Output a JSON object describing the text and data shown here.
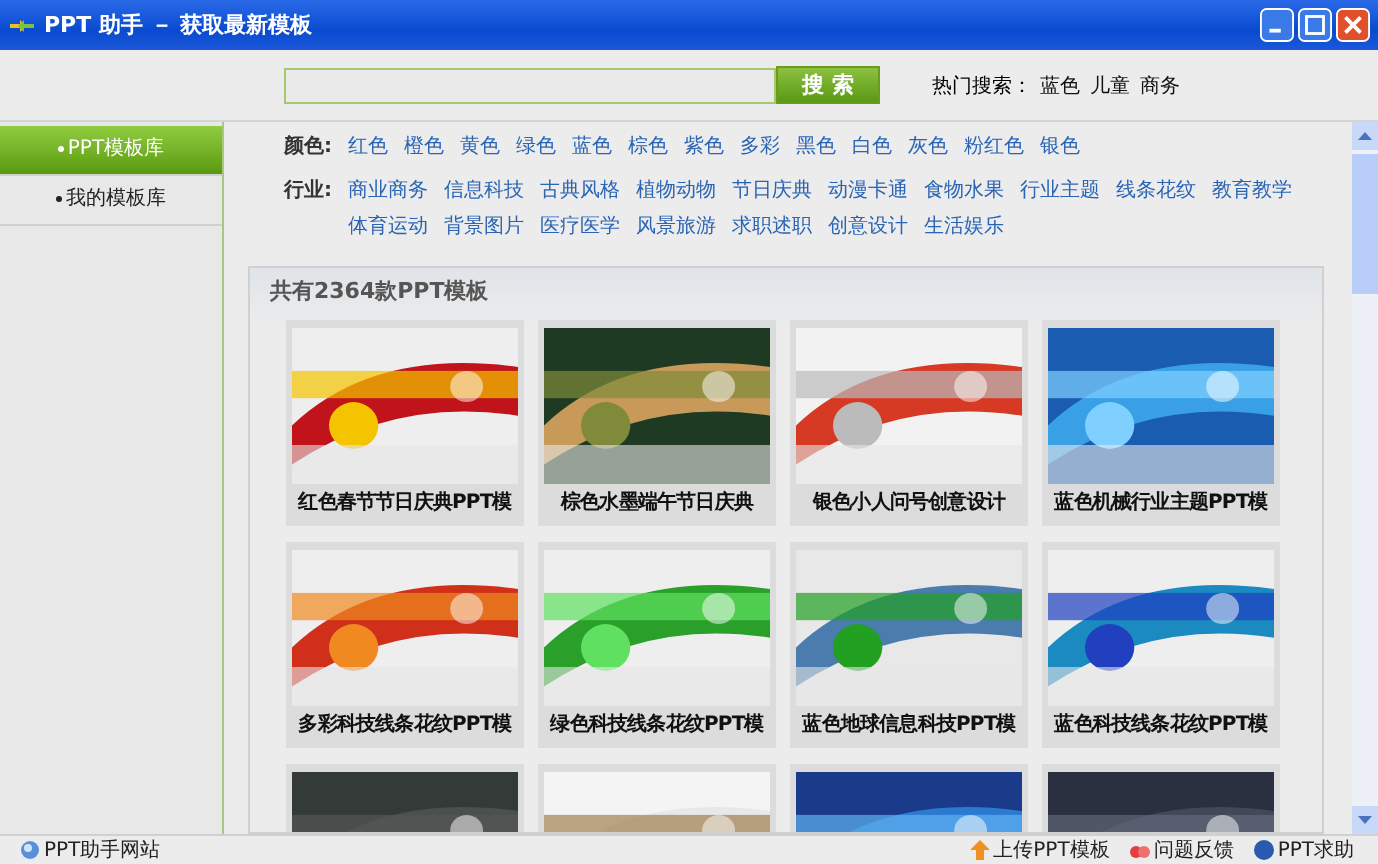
{
  "window": {
    "title": "PPT 助手 － 获取最新模板"
  },
  "search": {
    "button": "搜 索",
    "hot_label": "热门搜索：",
    "hot_terms": [
      "蓝色",
      "儿童",
      "商务"
    ]
  },
  "sidebar": {
    "items": [
      {
        "label": "PPT模板库",
        "selected": true
      },
      {
        "label": "我的模板库",
        "selected": false
      }
    ]
  },
  "filters": [
    {
      "label": "颜色:",
      "options": [
        "红色",
        "橙色",
        "黄色",
        "绿色",
        "蓝色",
        "棕色",
        "紫色",
        "多彩",
        "黑色",
        "白色",
        "灰色",
        "粉红色",
        "银色"
      ]
    },
    {
      "label": "行业:",
      "options": [
        "商业商务",
        "信息科技",
        "古典风格",
        "植物动物",
        "节日庆典",
        "动漫卡通",
        "食物水果",
        "行业主题",
        "线条花纹",
        "教育教学",
        "体育运动",
        "背景图片",
        "医疗医学",
        "风景旅游",
        "求职述职",
        "创意设计",
        "生活娱乐"
      ]
    }
  ],
  "gallery": {
    "title": "共有2364款PPT模板",
    "templates": [
      {
        "title": "红色春节节日庆典PPT模",
        "kind": "picture"
      },
      {
        "title": "棕色水墨端午节日庆典",
        "kind": "picture"
      },
      {
        "title": "银色小人问号创意设计",
        "kind": "picture"
      },
      {
        "title": "蓝色机械行业主题PPT模",
        "kind": "picture"
      },
      {
        "title": "多彩科技线条花纹PPT模",
        "kind": "picture"
      },
      {
        "title": "绿色科技线条花纹PPT模",
        "kind": "picture"
      },
      {
        "title": "蓝色地球信息科技PPT模",
        "kind": "picture"
      },
      {
        "title": "蓝色科技线条花纹PPT模",
        "kind": "picture"
      },
      {
        "kind": "picture"
      },
      {
        "kind": "picture"
      },
      {
        "kind": "picture"
      },
      {
        "kind": "picture"
      }
    ]
  },
  "status_bar": {
    "site": "PPT助手网站",
    "links": [
      "上传PPT模板",
      "问题反馈",
      "PPT求助"
    ]
  }
}
